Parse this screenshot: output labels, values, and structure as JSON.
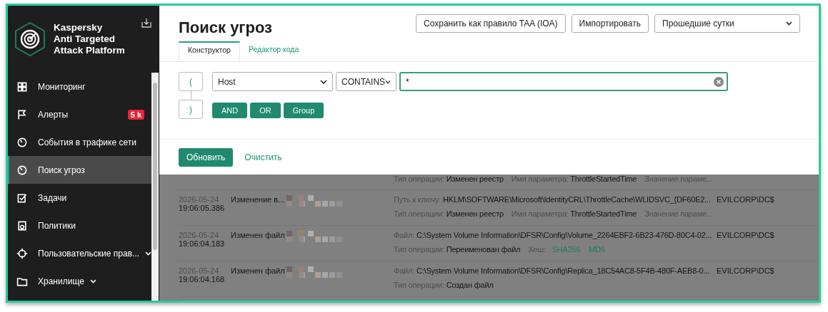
{
  "product": {
    "name_lines": [
      "Kaspersky",
      "Anti Targeted",
      "Attack Platform"
    ]
  },
  "sidebar": {
    "items": [
      {
        "label": "Мониторинг",
        "selected": false
      },
      {
        "label": "Алерты",
        "selected": false,
        "badge": "5 k"
      },
      {
        "label": "События в трафике сети",
        "selected": false
      },
      {
        "label": "Поиск угроз",
        "selected": true
      },
      {
        "label": "Задачи",
        "selected": false
      },
      {
        "label": "Политики",
        "selected": false
      },
      {
        "label": "Пользовательские прав...",
        "selected": false,
        "expandable": true
      },
      {
        "label": "Хранилище",
        "selected": false,
        "expandable": true
      }
    ]
  },
  "page": {
    "title": "Поиск угроз",
    "actions": [
      "Сохранить как правило TAA (IOA)",
      "Импортировать"
    ],
    "period": "Прошедшие сутки"
  },
  "tabs": [
    {
      "label": "Конструктор",
      "selected": true
    },
    {
      "label": "Редактор кода",
      "selected": false
    }
  ],
  "builder": {
    "open_paren": "(",
    "close_paren": ")",
    "field": "Host",
    "operator": "CONTAINS",
    "value": "*",
    "logic_buttons": [
      "AND",
      "OR",
      "Group"
    ]
  },
  "footer": {
    "primary": "Обновить",
    "secondary": "Очистить"
  },
  "results": {
    "dimmed": true,
    "rows": [
      {
        "lines": [
          [
            {
              "label": "Тип операции:",
              "value": "Изменен реестр"
            },
            {
              "label": "Имя параметра:",
              "value": "ThrottleStartedTime"
            },
            {
              "label": "Значение параме..."
            }
          ]
        ]
      },
      {
        "date": "2026-05-24",
        "time": "19:06:05.386",
        "event": "Изменение в...",
        "user": "EVILCORP\\DC$",
        "lines": [
          [
            {
              "label": "Путь к ключу:",
              "value": "HKLM\\SOFTWARE\\Microsoft\\IdentityCRL\\ThrottleCache\\WLIDSVC_{DF60E2..."
            }
          ],
          [
            {
              "label": "Тип операции:",
              "value": "Изменен реестр"
            },
            {
              "label": "Имя параметра:",
              "value": "ThrottleStartedTime"
            },
            {
              "label": "Значение параме..."
            }
          ]
        ]
      },
      {
        "date": "2026-05-24",
        "time": "19:06:04.183",
        "event": "Изменен файл",
        "user": "EVILCORP\\DC$",
        "lines": [
          [
            {
              "label": "Файл:",
              "value": "C:\\System Volume Information\\DFSR\\Config\\Volume_2264EBF2-6B23-476D-80C4-02..."
            }
          ],
          [
            {
              "label": "Тип операции:",
              "value": "Переименован файл"
            },
            {
              "label": "Хеш:",
              "links": [
                "SHA256",
                "MD5"
              ]
            }
          ]
        ]
      },
      {
        "date": "2026-05-24",
        "time": "19:06:04.168",
        "event": "Изменен файл",
        "user": "EVILCORP\\DC$",
        "lines": [
          [
            {
              "label": "Файл:",
              "value": "C:\\System Volume Information\\DFSR\\Config\\Replica_18C54AC8-5F4B-480F-AEB8-0..."
            }
          ],
          [
            {
              "label": "Тип операции:",
              "value": "Создан файл"
            }
          ]
        ]
      }
    ]
  }
}
